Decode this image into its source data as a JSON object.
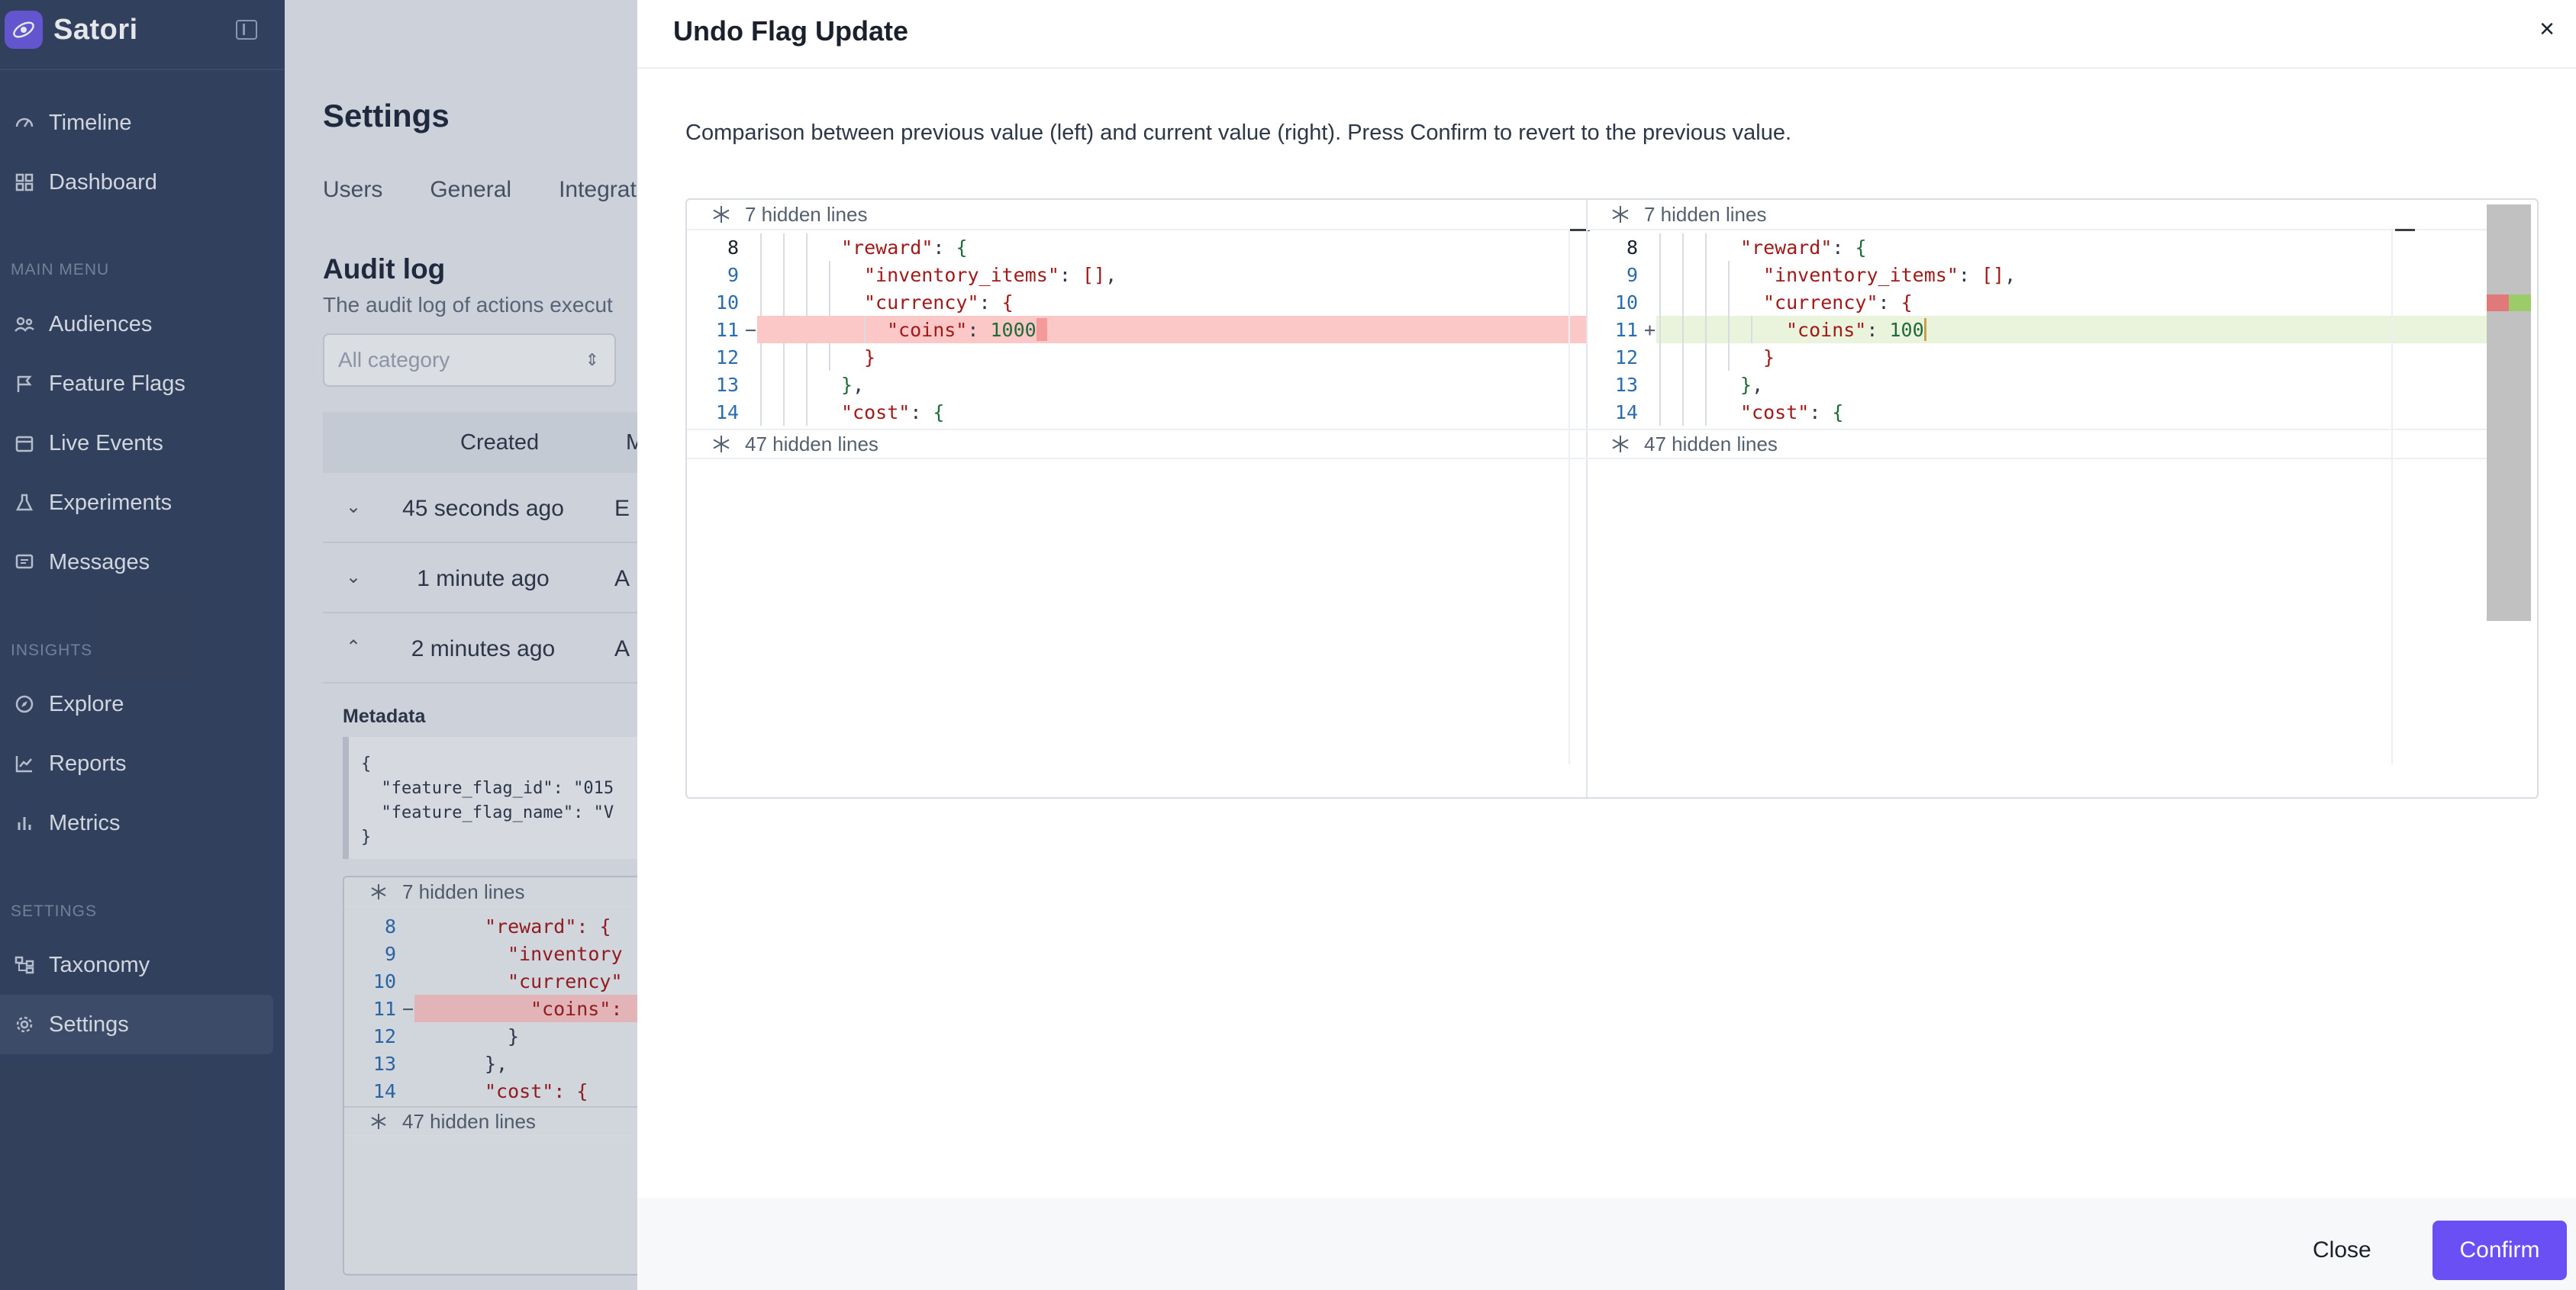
{
  "brand": {
    "name": "Satori"
  },
  "sidebar": {
    "top_items": [
      {
        "label": "Timeline",
        "icon": "timeline-icon"
      },
      {
        "label": "Dashboard",
        "icon": "dashboard-icon"
      }
    ],
    "sections": [
      {
        "label": "MAIN MENU",
        "items": [
          {
            "label": "Audiences",
            "icon": "users-icon"
          },
          {
            "label": "Feature Flags",
            "icon": "flag-icon"
          },
          {
            "label": "Live Events",
            "icon": "calendar-icon"
          },
          {
            "label": "Experiments",
            "icon": "flask-icon"
          },
          {
            "label": "Messages",
            "icon": "message-icon"
          }
        ]
      },
      {
        "label": "INSIGHTS",
        "items": [
          {
            "label": "Explore",
            "icon": "compass-icon"
          },
          {
            "label": "Reports",
            "icon": "report-icon"
          },
          {
            "label": "Metrics",
            "icon": "bar-chart-icon"
          }
        ]
      },
      {
        "label": "SETTINGS",
        "items": [
          {
            "label": "Taxonomy",
            "icon": "taxonomy-icon"
          },
          {
            "label": "Settings",
            "icon": "gear-icon",
            "active": true
          }
        ]
      }
    ]
  },
  "page": {
    "title": "Settings",
    "tabs": [
      "Users",
      "General",
      "Integrat"
    ],
    "audit_title": "Audit log",
    "audit_subtitle": "The audit log of actions execut",
    "category_placeholder": "All category",
    "table_header": {
      "created": "Created",
      "m": "M"
    },
    "rows": [
      {
        "time": "45 seconds ago",
        "action": "E",
        "expanded": false
      },
      {
        "time": "1 minute ago",
        "action": "A",
        "expanded": false
      },
      {
        "time": "2 minutes ago",
        "action": "A",
        "expanded": true
      }
    ],
    "metadata_label": "Metadata",
    "metadata_lines": [
      "{",
      "  \"feature_flag_id\": \"015",
      "  \"feature_flag_name\": \"V",
      "}"
    ],
    "mini_diff": {
      "top_hidden": "7 hidden lines",
      "bottom_hidden": "47 hidden lines",
      "lines": [
        {
          "n": "8",
          "text": "\"reward\": {"
        },
        {
          "n": "9",
          "text": "\"inventory"
        },
        {
          "n": "10",
          "text": "\"currency\""
        },
        {
          "n": "11",
          "text": "\"coins\":"
        },
        {
          "n": "12",
          "text": "}"
        },
        {
          "n": "13",
          "text": "},"
        },
        {
          "n": "14",
          "text": "\"cost\": {"
        }
      ]
    }
  },
  "modal": {
    "title": "Undo Flag Update",
    "close_icon": "×",
    "description": "Comparison between previous value (left) and current value (right). Press Confirm to revert to the previous value.",
    "diff": {
      "top_hidden": "7 hidden lines",
      "bottom_hidden": "47 hidden lines",
      "left_changed_value": "1000",
      "right_changed_value": "100",
      "colors": {
        "deleted": "#fcc7c7",
        "inserted": "#eaf3dc"
      }
    },
    "close_label": "Close",
    "confirm_label": "Confirm",
    "confirm_color": "#6a4ff5"
  }
}
